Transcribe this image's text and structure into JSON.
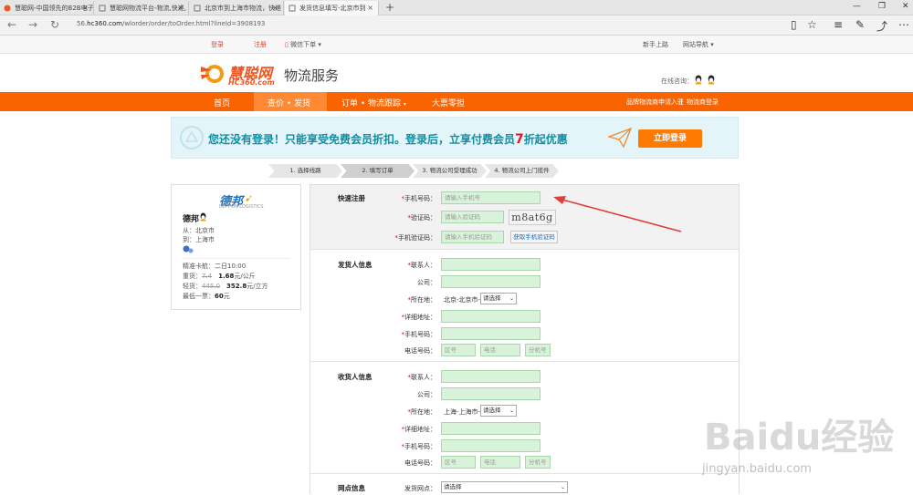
{
  "browser": {
    "tabs": [
      {
        "title": "慧聪网-中国领先的B2B电子"
      },
      {
        "title": "慧聪网物流平台-物流,快递,"
      },
      {
        "title": "北京市到上海市物流，快递"
      },
      {
        "title": "发货信息填写-北京市到"
      }
    ],
    "url_prefix": "56.",
    "url_domain": "hc360.com",
    "url_path": "/wlorder/order/toOrder.html?lineId=3908193"
  },
  "topbar": {
    "login": "登录",
    "register": "注册",
    "wechat_order": "微信下单",
    "newbie": "新手上路",
    "site_nav": "网站导航"
  },
  "header": {
    "logo_cn": "慧聪网",
    "logo_en": "HC360.com",
    "service_title": "物流服务",
    "online_service": "在线咨询："
  },
  "nav": {
    "home": "首页",
    "quote_ship": "查价 • 发货",
    "order_track": "订单 • 物流跟踪",
    "bid": "大票零担",
    "join": "品牌物流商申请入驻",
    "pipe": "|",
    "logistics_login": "物流商登录"
  },
  "banner": {
    "message_a": "您还没有登录！只能享受免费会员折扣。登录后，立享付费会员",
    "message_num": "7",
    "message_b": "折起优惠",
    "login_btn": "立即登录"
  },
  "steps": [
    "1. 选择线路",
    "2. 填写订单",
    "3. 物流公司受理成功",
    "4. 物流公司上门揽件"
  ],
  "carrier": {
    "logo": "德邦",
    "logo_sub": "DEPPON LOGISTICS",
    "name": "德邦",
    "from_label": "从：",
    "from": "北京市",
    "to_label": "到：",
    "to": "上海市",
    "time_label": "精准卡航：",
    "time": "二日10:00",
    "heavy_label": "重货：",
    "heavy_old": "7.4",
    "heavy_new": "1.68",
    "heavy_unit": "元/公斤",
    "light_label": "轻货：",
    "light_old": "445.0",
    "light_new": "352.8",
    "light_unit": "元/立方",
    "min_label": "最低一票：",
    "min_value": "60",
    "min_unit": "元"
  },
  "quick_register": {
    "title": "快速注册",
    "phone_label": "手机号码：",
    "phone_placeholder": "请输入手机号",
    "code_label": "验证码：",
    "code_placeholder": "请输入验证码",
    "captcha": "m8at6g",
    "sms_label": "手机验证码：",
    "sms_placeholder": "请输入手机验证码",
    "sms_btn": "获取手机验证码"
  },
  "sender": {
    "title": "发货人信息",
    "contact": "联系人：",
    "company": "公司：",
    "location": "所在地：",
    "location_value": "北京-北京市-",
    "select_default": "请选择",
    "address": "详细地址：",
    "mobile": "手机号码：",
    "tel": "电话号码：",
    "area_ph": "区号",
    "tel_ph": "电话",
    "ext_ph": "分机号"
  },
  "receiver": {
    "title": "收货人信息",
    "contact": "联系人：",
    "company": "公司：",
    "location": "所在地：",
    "location_value": "上海-上海市-",
    "select_default": "请选择",
    "address": "详细地址：",
    "mobile": "手机号码：",
    "tel": "电话号码：",
    "area_ph": "区号",
    "tel_ph": "电话",
    "ext_ph": "分机号"
  },
  "outlet": {
    "title": "网点信息",
    "label": "发货网点：",
    "value": "请选择"
  },
  "watermark": {
    "big": "Baidu经验",
    "small": "jingyan.baidu.com"
  },
  "colors": {
    "nav_orange": "#fa6400",
    "input_green": "#d8f3d9",
    "banner_text": "#0e8fa7",
    "arrow_red": "#e23b3b"
  }
}
